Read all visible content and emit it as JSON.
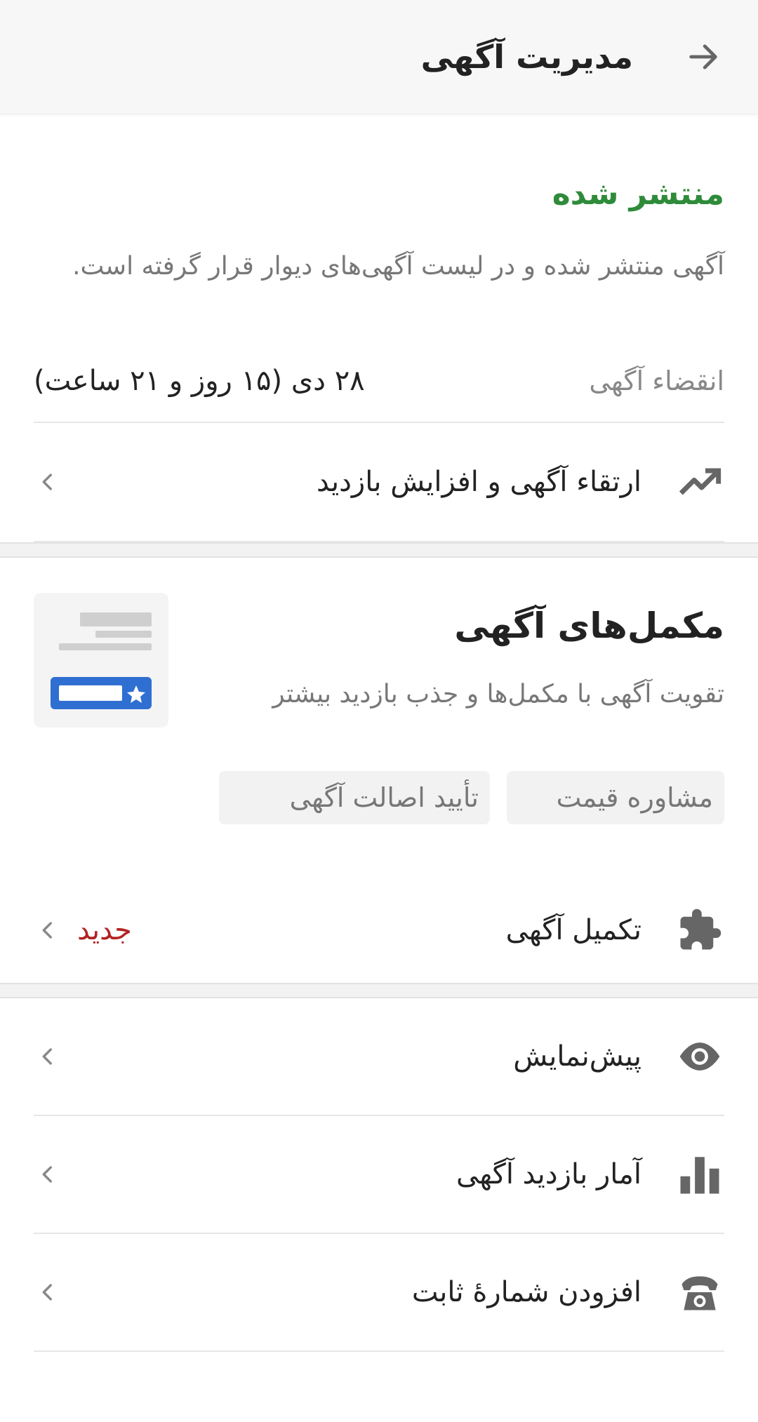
{
  "header": {
    "title": "مدیریت آگهی"
  },
  "status": {
    "title": "منتشر شده",
    "description": "آگهی منتشر شده و در لیست آگهی‌های دیوار قرار گرفته است."
  },
  "expiry": {
    "label": "انقضاء آگهی",
    "value": "۲۸ دی (۱۵ روز و ۲۱ ساعت)"
  },
  "promote": {
    "label": "ارتقاء آگهی و افزایش بازدید",
    "icon": "trending-up-icon"
  },
  "addons": {
    "title": "مکمل‌های آگهی",
    "description": "تقویت آگهی با مکمل‌ها و جذب بازدید بیشتر",
    "chips": [
      "مشاوره قیمت",
      "تأیید اصالت آگهی"
    ],
    "complete": {
      "label": "تکمیل آگهی",
      "badge": "جدید",
      "icon": "puzzle-icon"
    }
  },
  "actions": [
    {
      "label": "پیش‌نمایش",
      "icon": "eye-icon"
    },
    {
      "label": "آمار بازدید آگهی",
      "icon": "bar-chart-icon"
    },
    {
      "label": "افزودن شمارهٔ ثابت",
      "icon": "phone-icon"
    }
  ],
  "colors": {
    "published": "#2e8b3a",
    "new_badge": "#b22222",
    "icon": "#666666",
    "accent_blue": "#2f6fd1"
  }
}
